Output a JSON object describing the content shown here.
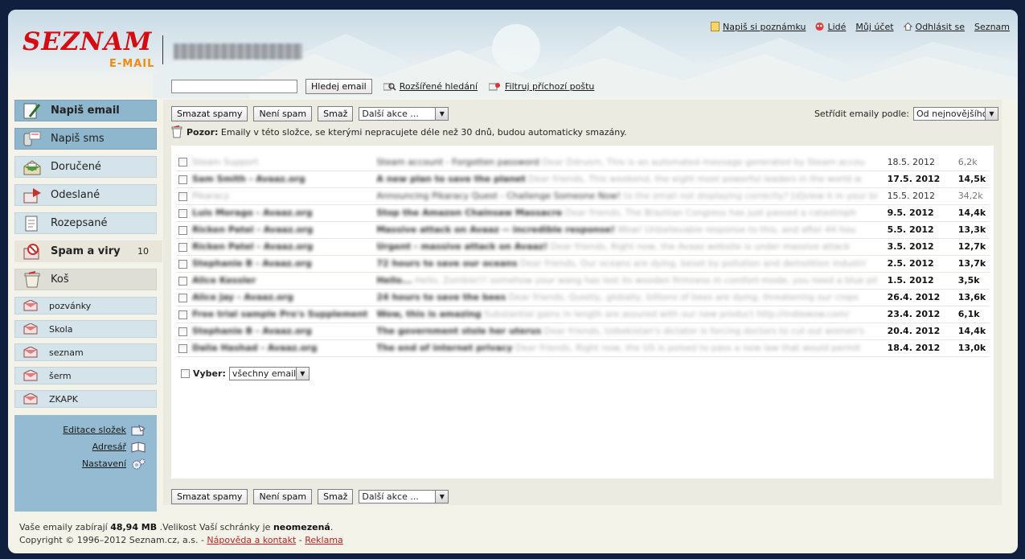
{
  "header": {
    "logo_main": "SEZNAM",
    "logo_sub": "E-MAIL",
    "top_links": [
      {
        "label": "Napiš si poznámku",
        "icon": "note-icon"
      },
      {
        "label": "Lidé",
        "icon": "people-icon"
      },
      {
        "label": "Můj účet",
        "icon": ""
      },
      {
        "label": "Odhlásit se",
        "icon": "logout-icon"
      },
      {
        "label": "Seznam",
        "icon": ""
      }
    ],
    "search": {
      "placeholder": "",
      "button": "Hledej email",
      "advanced": "Rozšířené hledání",
      "filter": "Filtruj příchozí poštu"
    }
  },
  "sidebar": {
    "items": [
      {
        "label": "Napiš email",
        "icon": "compose-pencil-icon",
        "count": ""
      },
      {
        "label": "Napiš sms",
        "icon": "sms-phone-icon",
        "count": ""
      },
      {
        "label": "Doručené",
        "icon": "inbox-icon",
        "count": ""
      },
      {
        "label": "Odeslané",
        "icon": "sent-icon",
        "count": ""
      },
      {
        "label": "Rozepsané",
        "icon": "drafts-icon",
        "count": ""
      },
      {
        "label": "Spam a viry",
        "icon": "spam-icon",
        "count": "10"
      },
      {
        "label": "Koš",
        "icon": "trash-icon",
        "count": ""
      }
    ],
    "folders": [
      "pozvánky",
      "Skola",
      "seznam",
      "šerm",
      "ZKAPK"
    ],
    "links": [
      "Editace složek",
      "Adresář",
      "Nastavení"
    ]
  },
  "toolbar": {
    "delete_spam": "Smazat spamy",
    "not_spam": "Není spam",
    "delete": "Smaž",
    "more_actions": "Další akce ...",
    "sort_label": "Setřídit emaily podle:",
    "sort_value": "Od nejnovějšího"
  },
  "warning": {
    "title": "Pozor:",
    "text": "Emaily v této složce, se kterými nepracujete déle než 30 dnů, budou automaticky smazány."
  },
  "emails": [
    {
      "from": "Steam Support",
      "subject": "Steam account - Forgotten password",
      "snippet": "Dear Ddrusm, This is an automated message generated by Steam accou",
      "date": "18.5. 2012",
      "size": "6,2k",
      "unread": false
    },
    {
      "from": "Sam Smith - Avaaz.org",
      "subject": "A new plan to save the planet",
      "snippet": "Dear friends, This weekend, the eight most powerful leaders in the world w",
      "date": "17.5. 2012",
      "size": "14,5k",
      "unread": true
    },
    {
      "from": "Pikaracy",
      "subject": "Announcing Pikaracy Quest - Challenge Someone Now!",
      "snippet": "to the email not displaying correctly? [d]view it in your br",
      "date": "15.5. 2012",
      "size": "34,2k",
      "unread": false
    },
    {
      "from": "Luis Morago - Avaaz.org",
      "subject": "Stop the Amazon Chainsaw Massacre",
      "snippet": "Dear friends, The Brazilian Congress has just passed a catastroph",
      "date": "9.5. 2012",
      "size": "14,4k",
      "unread": true
    },
    {
      "from": "Ricken Patel - Avaaz.org",
      "subject": "Massive attack on Avaaz -- incredible response!",
      "snippet": "Wow! Unbelievable response to this, and after 44 hou",
      "date": "5.5. 2012",
      "size": "13,3k",
      "unread": true
    },
    {
      "from": "Ricken Patel - Avaaz.org",
      "subject": "Urgent - massive attack on Avaaz!",
      "snippet": "Dear friends, Right now, the Avaaz website is under massive attack",
      "date": "3.5. 2012",
      "size": "12,7k",
      "unread": true
    },
    {
      "from": "Stephanie B - Avaaz.org",
      "subject": "72 hours to save our oceans",
      "snippet": "Dear friends, Our oceans are dying, beset by pollution and demolition industri",
      "date": "2.5. 2012",
      "size": "13,7k",
      "unread": true
    },
    {
      "from": "Alice Kessler",
      "subject": "Hello...",
      "snippet": "Hello, Zombie!!! somehow your wang has lost its wooden firmness in comfort-mode, you need a blue pil",
      "date": "1.5. 2012",
      "size": "3,5k",
      "unread": true
    },
    {
      "from": "Alice Jay - Avaaz.org",
      "subject": "24 hours to save the bees",
      "snippet": "Dear friends, Quietly, globally, billions of bees are dying, threatening our crops",
      "date": "26.4. 2012",
      "size": "13,6k",
      "unread": true
    },
    {
      "from": "Free trial sample Pro's Supplement",
      "subject": "Wow, this is amazing",
      "snippet": "Substantial gains in length are assured with our new product http://indiewow.com/",
      "date": "23.4. 2012",
      "size": "6,1k",
      "unread": true
    },
    {
      "from": "Stephanie B - Avaaz.org",
      "subject": "The government stole her uterus",
      "snippet": "Dear friends, Uzbekistan's dictator is forcing doctors to cut out women's",
      "date": "20.4. 2012",
      "size": "14,4k",
      "unread": true
    },
    {
      "from": "Dalia Hashad - Avaaz.org",
      "subject": "The end of internet privacy",
      "snippet": "Dear friends, Right now, the US is poised to pass a new law that would permit",
      "date": "18.4. 2012",
      "size": "13,0k",
      "unread": true
    }
  ],
  "select": {
    "label": "Vyber:",
    "value": "všechny emaily"
  },
  "footer": {
    "usage_prefix": "Vaše emaily zabírají",
    "usage_value": "48,94 MB",
    "usage_mid": ".Velikost Vaší schránky je",
    "usage_cap": "neomezená",
    "usage_end": ".",
    "copyright": "Copyright © 1996–2012 Seznam.cz, a.s. -",
    "help": "Nápověda a kontakt",
    "separator": "-",
    "ads": "Reklama"
  },
  "colors": {
    "accent_red": "#d40c12",
    "accent_orange": "#f08c14",
    "nav_blue": "#8eb6cc",
    "nav_light": "#d5e4ea"
  }
}
